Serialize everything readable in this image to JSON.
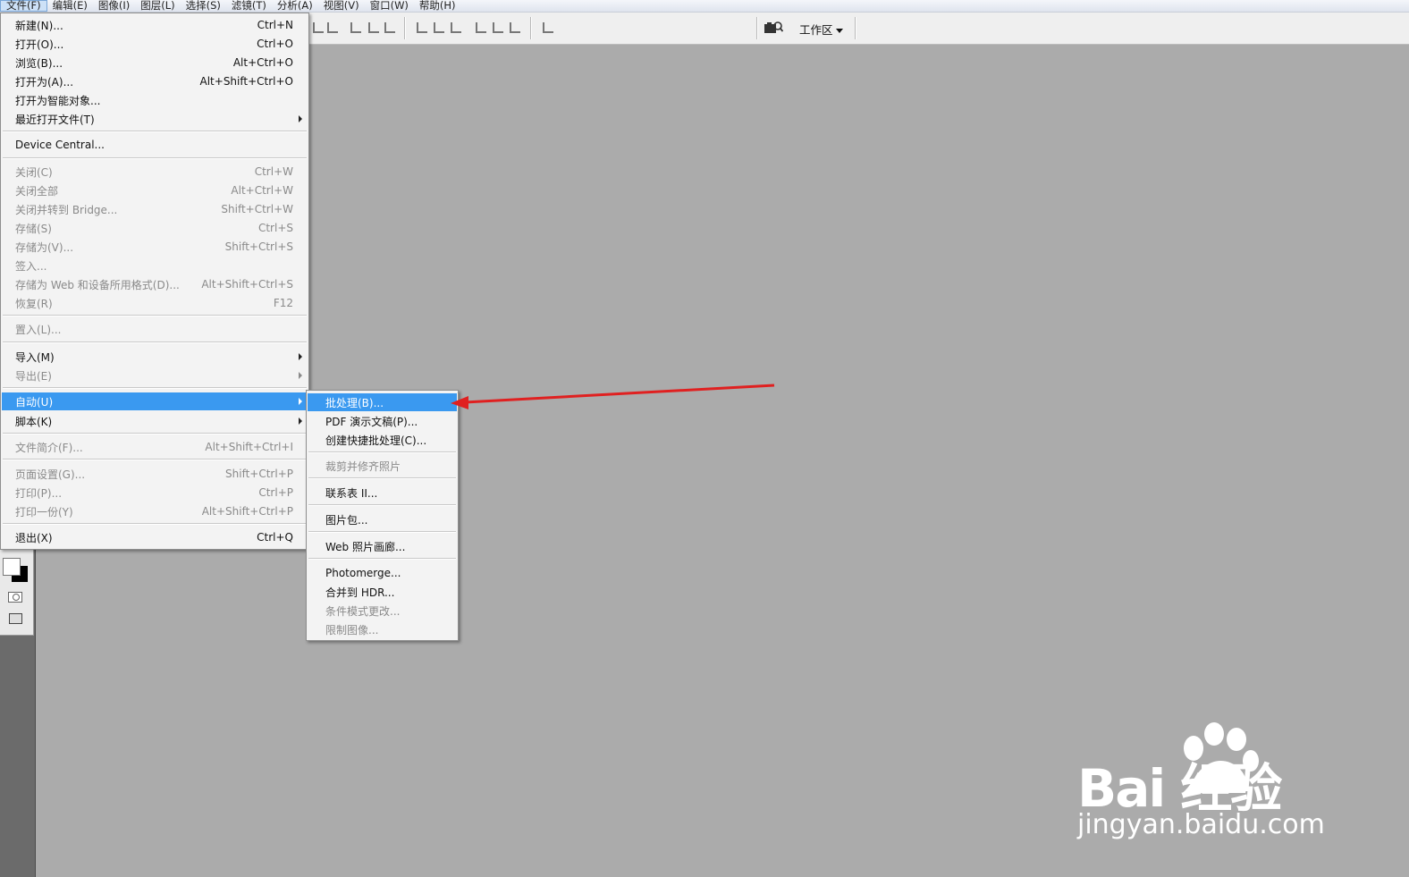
{
  "menubar": {
    "items": [
      {
        "label": "文件(F)",
        "active": true
      },
      {
        "label": "编辑(E)"
      },
      {
        "label": "图像(I)"
      },
      {
        "label": "图层(L)"
      },
      {
        "label": "选择(S)"
      },
      {
        "label": "滤镜(T)"
      },
      {
        "label": "分析(A)"
      },
      {
        "label": "视图(V)"
      },
      {
        "label": "窗口(W)"
      },
      {
        "label": "帮助(H)"
      }
    ]
  },
  "toolbar": {
    "workspace_label": "工作区",
    "icons": [
      "align-icon",
      "camera-icon"
    ]
  },
  "file_menu": {
    "items": [
      {
        "label": "新建(N)...",
        "shortcut": "Ctrl+N"
      },
      {
        "label": "打开(O)...",
        "shortcut": "Ctrl+O"
      },
      {
        "label": "浏览(B)...",
        "shortcut": "Alt+Ctrl+O"
      },
      {
        "label": "打开为(A)...",
        "shortcut": "Alt+Shift+Ctrl+O"
      },
      {
        "label": "打开为智能对象...",
        "shortcut": ""
      },
      {
        "label": "最近打开文件(T)",
        "shortcut": "",
        "submenu": true
      },
      {
        "label": "Device Central...",
        "shortcut": ""
      },
      {
        "label": "关闭(C)",
        "shortcut": "Ctrl+W",
        "disabled": true
      },
      {
        "label": "关闭全部",
        "shortcut": "Alt+Ctrl+W",
        "disabled": true
      },
      {
        "label": "关闭并转到 Bridge...",
        "shortcut": "Shift+Ctrl+W",
        "disabled": true
      },
      {
        "label": "存储(S)",
        "shortcut": "Ctrl+S",
        "disabled": true
      },
      {
        "label": "存储为(V)...",
        "shortcut": "Shift+Ctrl+S",
        "disabled": true
      },
      {
        "label": "签入...",
        "shortcut": "",
        "disabled": true
      },
      {
        "label": "存储为 Web 和设备所用格式(D)...",
        "shortcut": "Alt+Shift+Ctrl+S",
        "disabled": true
      },
      {
        "label": "恢复(R)",
        "shortcut": "F12",
        "disabled": true
      },
      {
        "label": "置入(L)...",
        "shortcut": "",
        "disabled": true
      },
      {
        "label": "导入(M)",
        "shortcut": "",
        "submenu": true
      },
      {
        "label": "导出(E)",
        "shortcut": "",
        "submenu": true,
        "disabled": true
      },
      {
        "label": "自动(U)",
        "shortcut": "",
        "submenu": true,
        "highlight": true
      },
      {
        "label": "脚本(K)",
        "shortcut": "",
        "submenu": true
      },
      {
        "label": "文件简介(F)...",
        "shortcut": "Alt+Shift+Ctrl+I",
        "disabled": true
      },
      {
        "label": "页面设置(G)...",
        "shortcut": "Shift+Ctrl+P",
        "disabled": true
      },
      {
        "label": "打印(P)...",
        "shortcut": "Ctrl+P",
        "disabled": true
      },
      {
        "label": "打印一份(Y)",
        "shortcut": "Alt+Shift+Ctrl+P",
        "disabled": true
      },
      {
        "label": "退出(X)",
        "shortcut": "Ctrl+Q"
      }
    ]
  },
  "auto_submenu": {
    "items": [
      {
        "label": "批处理(B)...",
        "highlight": true
      },
      {
        "label": "PDF 演示文稿(P)..."
      },
      {
        "label": "创建快捷批处理(C)..."
      },
      {
        "label": "裁剪并修齐照片",
        "disabled": true
      },
      {
        "label": "联系表 II..."
      },
      {
        "label": "图片包..."
      },
      {
        "label": "Web 照片画廊..."
      },
      {
        "label": "Photomerge..."
      },
      {
        "label": "合并到 HDR..."
      },
      {
        "label": "条件模式更改...",
        "disabled": true
      },
      {
        "label": "限制图像...",
        "disabled": true
      }
    ]
  },
  "annotation": {
    "color": "#e02020"
  },
  "watermark": {
    "brand": "Bai  经验",
    "url": "jingyan.baidu.com"
  },
  "colors": {
    "highlight": "#3a99f0",
    "canvas": "#ababab",
    "menu_bg": "#f3f3f3"
  }
}
